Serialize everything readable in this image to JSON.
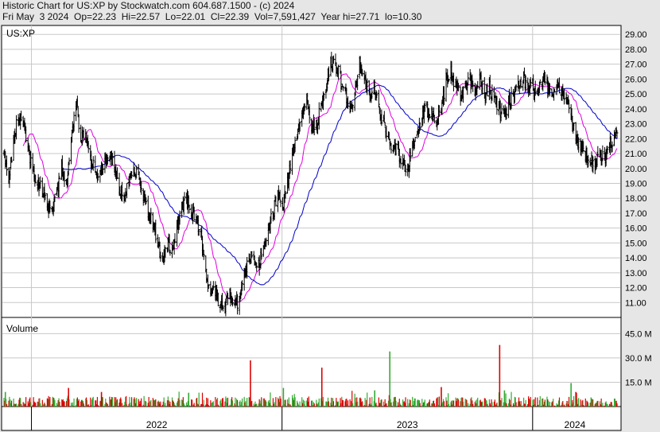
{
  "header": {
    "line1": "Historic Chart for US:XP by Stockwatch.com 604.687.1500 - (c) 2024",
    "line2": "Fri May  3 2024  Op=22.23  Hi=22.57  Lo=22.01  Cl=22.39  Vol=7,591,427  Year hi=27.71  lo=10.30"
  },
  "colors": {
    "price_bar": "#000000",
    "ma_short": "#e000e0",
    "ma_long": "#0000cc",
    "volume_up": "#33aa33",
    "volume_down": "#dd0000",
    "grid": "#c8c8c8",
    "background": "#ffffff",
    "page": "#e6e6e6"
  },
  "chart_data": [
    {
      "type": "ohlc",
      "panel": "price",
      "symbol_label": "US:XP",
      "y_ticks": [
        "29.00",
        "28.00",
        "27.00",
        "26.00",
        "25.00",
        "24.00",
        "23.00",
        "22.00",
        "21.00",
        "20.00",
        "19.00",
        "18.00",
        "17.00",
        "16.00",
        "15.00",
        "14.00",
        "13.00",
        "12.00",
        "11.00"
      ],
      "ylim": [
        10.0,
        29.6
      ],
      "grid": true,
      "x_labels": [
        "2022",
        "2023",
        "2024"
      ],
      "x_range": [
        "2021-11-22",
        "2024-05-03"
      ],
      "anchors": [
        {
          "date": "2021-11-22",
          "close": 21.0
        },
        {
          "date": "2021-11-29",
          "close": 19.0
        },
        {
          "date": "2021-12-06",
          "close": 22.0
        },
        {
          "date": "2021-12-13",
          "close": 23.5
        },
        {
          "date": "2021-12-20",
          "close": 23.0
        },
        {
          "date": "2021-12-27",
          "close": 21.5
        },
        {
          "date": "2022-01-03",
          "close": 19.5
        },
        {
          "date": "2022-01-10",
          "close": 19.0
        },
        {
          "date": "2022-01-17",
          "close": 18.5
        },
        {
          "date": "2022-01-24",
          "close": 17.5
        },
        {
          "date": "2022-01-31",
          "close": 17.2
        },
        {
          "date": "2022-02-07",
          "close": 18.5
        },
        {
          "date": "2022-02-14",
          "close": 20.0
        },
        {
          "date": "2022-02-21",
          "close": 19.0
        },
        {
          "date": "2022-02-28",
          "close": 22.0
        },
        {
          "date": "2022-03-07",
          "close": 24.5
        },
        {
          "date": "2022-03-14",
          "close": 22.0
        },
        {
          "date": "2022-03-21",
          "close": 22.5
        },
        {
          "date": "2022-03-28",
          "close": 20.5
        },
        {
          "date": "2022-04-04",
          "close": 20.0
        },
        {
          "date": "2022-04-11",
          "close": 19.5
        },
        {
          "date": "2022-04-18",
          "close": 20.5
        },
        {
          "date": "2022-04-25",
          "close": 21.0
        },
        {
          "date": "2022-05-02",
          "close": 20.0
        },
        {
          "date": "2022-05-09",
          "close": 18.5
        },
        {
          "date": "2022-05-16",
          "close": 18.0
        },
        {
          "date": "2022-05-23",
          "close": 19.0
        },
        {
          "date": "2022-05-30",
          "close": 20.0
        },
        {
          "date": "2022-06-06",
          "close": 19.5
        },
        {
          "date": "2022-06-13",
          "close": 18.0
        },
        {
          "date": "2022-06-20",
          "close": 17.0
        },
        {
          "date": "2022-06-27",
          "close": 16.5
        },
        {
          "date": "2022-07-04",
          "close": 15.0
        },
        {
          "date": "2022-07-11",
          "close": 14.0
        },
        {
          "date": "2022-07-18",
          "close": 15.0
        },
        {
          "date": "2022-07-25",
          "close": 14.5
        },
        {
          "date": "2022-08-01",
          "close": 16.0
        },
        {
          "date": "2022-08-08",
          "close": 17.5
        },
        {
          "date": "2022-08-15",
          "close": 18.0
        },
        {
          "date": "2022-08-22",
          "close": 17.0
        },
        {
          "date": "2022-08-29",
          "close": 16.5
        },
        {
          "date": "2022-09-05",
          "close": 15.5
        },
        {
          "date": "2022-09-12",
          "close": 13.0
        },
        {
          "date": "2022-09-19",
          "close": 12.0
        },
        {
          "date": "2022-09-26",
          "close": 11.5
        },
        {
          "date": "2022-10-03",
          "close": 11.0
        },
        {
          "date": "2022-10-10",
          "close": 10.8
        },
        {
          "date": "2022-10-17",
          "close": 11.5
        },
        {
          "date": "2022-10-24",
          "close": 11.0
        },
        {
          "date": "2022-10-31",
          "close": 11.0
        },
        {
          "date": "2022-11-07",
          "close": 13.0
        },
        {
          "date": "2022-11-14",
          "close": 14.0
        },
        {
          "date": "2022-11-21",
          "close": 14.0
        },
        {
          "date": "2022-11-28",
          "close": 13.5
        },
        {
          "date": "2022-12-05",
          "close": 14.5
        },
        {
          "date": "2022-12-12",
          "close": 16.0
        },
        {
          "date": "2022-12-19",
          "close": 17.0
        },
        {
          "date": "2022-12-26",
          "close": 18.5
        },
        {
          "date": "2023-01-02",
          "close": 17.5
        },
        {
          "date": "2023-01-09",
          "close": 19.0
        },
        {
          "date": "2023-01-16",
          "close": 21.0
        },
        {
          "date": "2023-01-23",
          "close": 22.0
        },
        {
          "date": "2023-01-30",
          "close": 23.5
        },
        {
          "date": "2023-02-06",
          "close": 24.5
        },
        {
          "date": "2023-02-13",
          "close": 23.0
        },
        {
          "date": "2023-02-20",
          "close": 23.0
        },
        {
          "date": "2023-02-27",
          "close": 24.0
        },
        {
          "date": "2023-03-06",
          "close": 25.5
        },
        {
          "date": "2023-03-13",
          "close": 27.0
        },
        {
          "date": "2023-03-20",
          "close": 27.0
        },
        {
          "date": "2023-03-27",
          "close": 26.0
        },
        {
          "date": "2023-04-03",
          "close": 25.0
        },
        {
          "date": "2023-04-10",
          "close": 24.0
        },
        {
          "date": "2023-04-17",
          "close": 25.0
        },
        {
          "date": "2023-04-24",
          "close": 27.0
        },
        {
          "date": "2023-05-01",
          "close": 26.0
        },
        {
          "date": "2023-05-08",
          "close": 25.0
        },
        {
          "date": "2023-05-15",
          "close": 25.5
        },
        {
          "date": "2023-05-22",
          "close": 24.0
        },
        {
          "date": "2023-05-29",
          "close": 23.0
        },
        {
          "date": "2023-06-05",
          "close": 22.0
        },
        {
          "date": "2023-06-12",
          "close": 21.5
        },
        {
          "date": "2023-06-19",
          "close": 21.0
        },
        {
          "date": "2023-06-26",
          "close": 20.5
        },
        {
          "date": "2023-07-03",
          "close": 20.0
        },
        {
          "date": "2023-07-10",
          "close": 21.5
        },
        {
          "date": "2023-07-17",
          "close": 22.5
        },
        {
          "date": "2023-07-24",
          "close": 23.5
        },
        {
          "date": "2023-07-31",
          "close": 24.0
        },
        {
          "date": "2023-08-07",
          "close": 23.5
        },
        {
          "date": "2023-08-14",
          "close": 23.0
        },
        {
          "date": "2023-08-21",
          "close": 24.0
        },
        {
          "date": "2023-08-28",
          "close": 26.0
        },
        {
          "date": "2023-09-04",
          "close": 26.5
        },
        {
          "date": "2023-09-11",
          "close": 25.5
        },
        {
          "date": "2023-09-18",
          "close": 25.0
        },
        {
          "date": "2023-09-25",
          "close": 25.5
        },
        {
          "date": "2023-10-02",
          "close": 26.0
        },
        {
          "date": "2023-10-09",
          "close": 25.0
        },
        {
          "date": "2023-10-16",
          "close": 26.0
        },
        {
          "date": "2023-10-23",
          "close": 25.0
        },
        {
          "date": "2023-10-30",
          "close": 25.5
        },
        {
          "date": "2023-11-06",
          "close": 24.5
        },
        {
          "date": "2023-11-13",
          "close": 24.0
        },
        {
          "date": "2023-11-20",
          "close": 23.5
        },
        {
          "date": "2023-11-27",
          "close": 24.5
        },
        {
          "date": "2023-12-04",
          "close": 25.0
        },
        {
          "date": "2023-12-11",
          "close": 25.5
        },
        {
          "date": "2023-12-18",
          "close": 26.0
        },
        {
          "date": "2023-12-25",
          "close": 25.5
        },
        {
          "date": "2024-01-01",
          "close": 25.5
        },
        {
          "date": "2024-01-08",
          "close": 25.0
        },
        {
          "date": "2024-01-15",
          "close": 26.0
        },
        {
          "date": "2024-01-22",
          "close": 25.5
        },
        {
          "date": "2024-01-29",
          "close": 25.0
        },
        {
          "date": "2024-02-05",
          "close": 25.5
        },
        {
          "date": "2024-02-12",
          "close": 25.0
        },
        {
          "date": "2024-02-19",
          "close": 24.5
        },
        {
          "date": "2024-02-26",
          "close": 23.5
        },
        {
          "date": "2024-03-04",
          "close": 22.0
        },
        {
          "date": "2024-03-11",
          "close": 21.5
        },
        {
          "date": "2024-03-18",
          "close": 21.0
        },
        {
          "date": "2024-03-25",
          "close": 20.5
        },
        {
          "date": "2024-04-01",
          "close": 20.5
        },
        {
          "date": "2024-04-08",
          "close": 21.0
        },
        {
          "date": "2024-04-15",
          "close": 20.5
        },
        {
          "date": "2024-04-22",
          "close": 21.5
        },
        {
          "date": "2024-05-03",
          "close": 22.39
        }
      ],
      "last_bar": {
        "date": "2024-05-03",
        "open": 22.23,
        "high": 22.57,
        "low": 22.01,
        "close": 22.39
      }
    },
    {
      "type": "bar",
      "panel": "volume",
      "title": "Volume",
      "y_ticks": [
        "45.0 M",
        "30.0 M",
        "15.0 M"
      ],
      "ylim": [
        0,
        55
      ],
      "unit": "M",
      "baseline_range": [
        0.5,
        6.0
      ],
      "spikes": [
        {
          "date": "2021-11-24",
          "value": 9.0,
          "dir": "up"
        },
        {
          "date": "2022-02-24",
          "value": 11.5,
          "dir": "down"
        },
        {
          "date": "2022-04-13",
          "value": 9.0,
          "dir": "down"
        },
        {
          "date": "2022-08-18",
          "value": 8.5,
          "dir": "up"
        },
        {
          "date": "2022-11-16",
          "value": 28.5,
          "dir": "down"
        },
        {
          "date": "2023-01-03",
          "value": 11.5,
          "dir": "up"
        },
        {
          "date": "2023-02-28",
          "value": 24.0,
          "dir": "down"
        },
        {
          "date": "2023-05-16",
          "value": 10.0,
          "dir": "up"
        },
        {
          "date": "2023-06-07",
          "value": 34.0,
          "dir": "up"
        },
        {
          "date": "2023-08-21",
          "value": 12.0,
          "dir": "down"
        },
        {
          "date": "2023-11-14",
          "value": 38.0,
          "dir": "down"
        },
        {
          "date": "2023-11-21",
          "value": 10.0,
          "dir": "up"
        },
        {
          "date": "2024-02-26",
          "value": 14.5,
          "dir": "up"
        },
        {
          "date": "2024-03-04",
          "value": 9.0,
          "dir": "down"
        }
      ]
    }
  ]
}
